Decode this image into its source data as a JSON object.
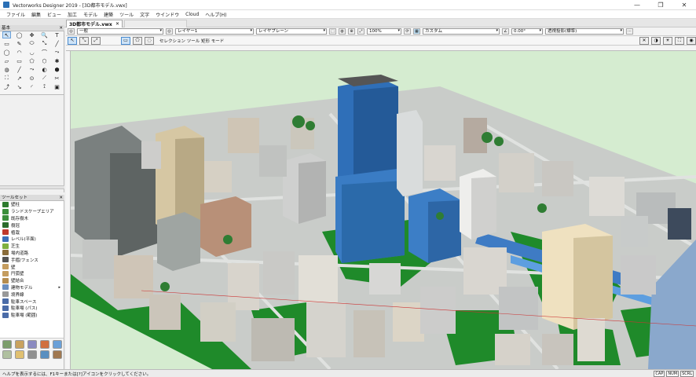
{
  "window": {
    "title": "Vectorworks Designer 2019 - [3D都市モデル.vwx]",
    "controls": [
      "—",
      "❐",
      "✕"
    ]
  },
  "menu": [
    "ファイル",
    "編集",
    "ビュー",
    "加工",
    "モデル",
    "建築",
    "ツール",
    "文字",
    "ウインドウ",
    "Cloud",
    "ヘルプ(H)"
  ],
  "document_tab": {
    "name": "3D都市モデル.vwx",
    "close": "✕"
  },
  "view_bar": {
    "class_value": "一般",
    "layer_value": "レイヤー1",
    "layer_plane_value": "レイヤプレーン",
    "zoom_value": "100%",
    "render_value": "カスタム",
    "angle_value": "0.00°",
    "view_value": "透視投影(標準)"
  },
  "mode_bar": {
    "mode_text": "セレクション ツール 矩形 モード"
  },
  "basic_palette": {
    "header": "基本",
    "close": "✕",
    "tools": [
      "↖",
      "◯",
      "✥",
      "🔍",
      "T",
      "▭",
      "✎",
      "⬭",
      "⤡",
      "╱",
      "◯",
      "◠",
      "◡",
      "⌒",
      "⤳",
      "▱",
      "▭",
      "⬠",
      "⬡",
      "✱",
      "◍",
      "╱",
      "⤳",
      "◐",
      "⬢",
      "⛶",
      "↗",
      "⊙",
      "⟋",
      "✂",
      "⤴",
      "↘",
      "◜",
      "⟟",
      "▣"
    ]
  },
  "toolsets": {
    "header": "ツールセット",
    "close": "✕",
    "items": [
      {
        "label": "壁柱",
        "color": "#2d7a2d"
      },
      {
        "label": "ランドスケープエリア",
        "color": "#3a8f3a"
      },
      {
        "label": "既存樹木",
        "color": "#3a8f3a"
      },
      {
        "label": "樹冠",
        "color": "#2b6b2b"
      },
      {
        "label": "植栽",
        "color": "#c0392b"
      },
      {
        "label": "レベル(平面)",
        "color": "#3d6fb8"
      },
      {
        "label": "芝生",
        "color": "#7fb03f"
      },
      {
        "label": "場内道路",
        "color": "#8a6d3b"
      },
      {
        "label": "手摺/フェンス",
        "color": "#555555"
      },
      {
        "label": "壁",
        "color": "#c59d5f"
      },
      {
        "label": "円弧壁",
        "color": "#c59d5f"
      },
      {
        "label": "壁結合",
        "color": "#b58d4f"
      },
      {
        "label": "建物モデル",
        "color": "#6b8fbf",
        "more": "▸"
      },
      {
        "label": "境界線",
        "color": "#999999"
      },
      {
        "label": "駐車スペース",
        "color": "#4b6ca8"
      },
      {
        "label": "駐車場 (パス)",
        "color": "#4b6ca8"
      },
      {
        "label": "駐車場 (範囲)",
        "color": "#4b6ca8"
      }
    ]
  },
  "status": {
    "help": "ヘルプを表示するには、F1キーまたは[?]アイコンをクリックしてください。",
    "indicators": [
      "CAP",
      "NUM",
      "SCRL"
    ]
  },
  "colors": {
    "sky": "#d5ecd0",
    "grass": "#1f8a2a",
    "road": "#c9ccc9",
    "tower_blue": "#2f6fb8",
    "highway": "#3e7bc4"
  }
}
